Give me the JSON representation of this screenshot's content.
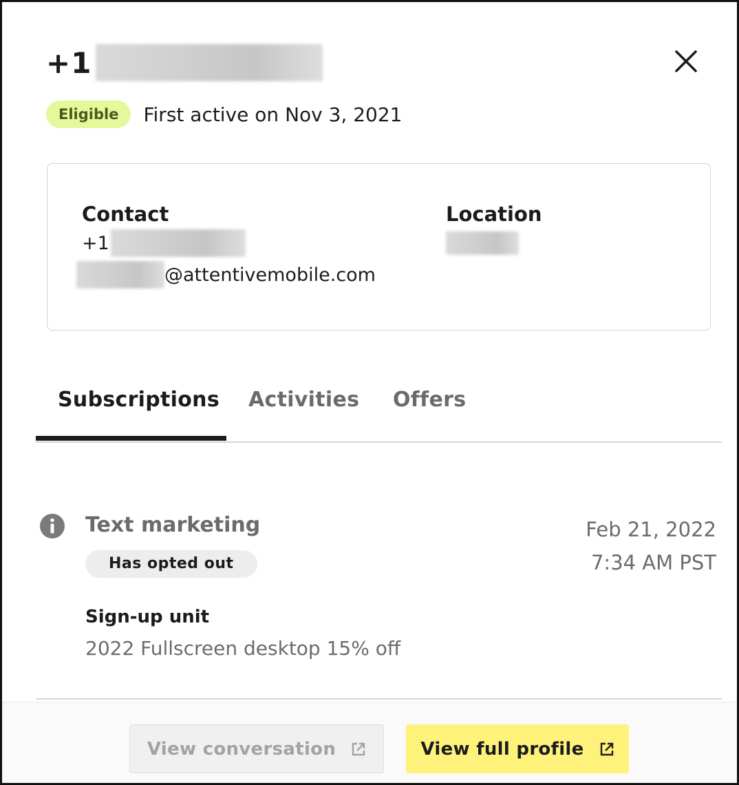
{
  "header": {
    "title_prefix": "+1",
    "status_badge": "Eligible",
    "first_active": "First active on Nov 3, 2021",
    "close_icon": "close-icon"
  },
  "contact_card": {
    "contact_heading": "Contact",
    "phone_prefix": "+1",
    "email_suffix": "@attentivemobile.com",
    "location_heading": "Location"
  },
  "tabs": [
    {
      "label": "Subscriptions",
      "active": true
    },
    {
      "label": "Activities",
      "active": false
    },
    {
      "label": "Offers",
      "active": false
    }
  ],
  "subscription": {
    "icon": "info-icon",
    "title": "Text marketing",
    "status": "Has opted out",
    "date": "Feb 21, 2022",
    "time": "7:34 AM PST",
    "signup_label": "Sign-up unit",
    "signup_value": "2022 Fullscreen desktop 15% off"
  },
  "footer": {
    "secondary_label": "View conversation",
    "primary_label": "View full profile",
    "button_icon": "external-link-icon"
  },
  "colors": {
    "eligible_bg": "#e6f89c",
    "primary_button": "#fff27a",
    "text_dark": "#1b1b1f",
    "text_muted": "#6b6b6b"
  }
}
